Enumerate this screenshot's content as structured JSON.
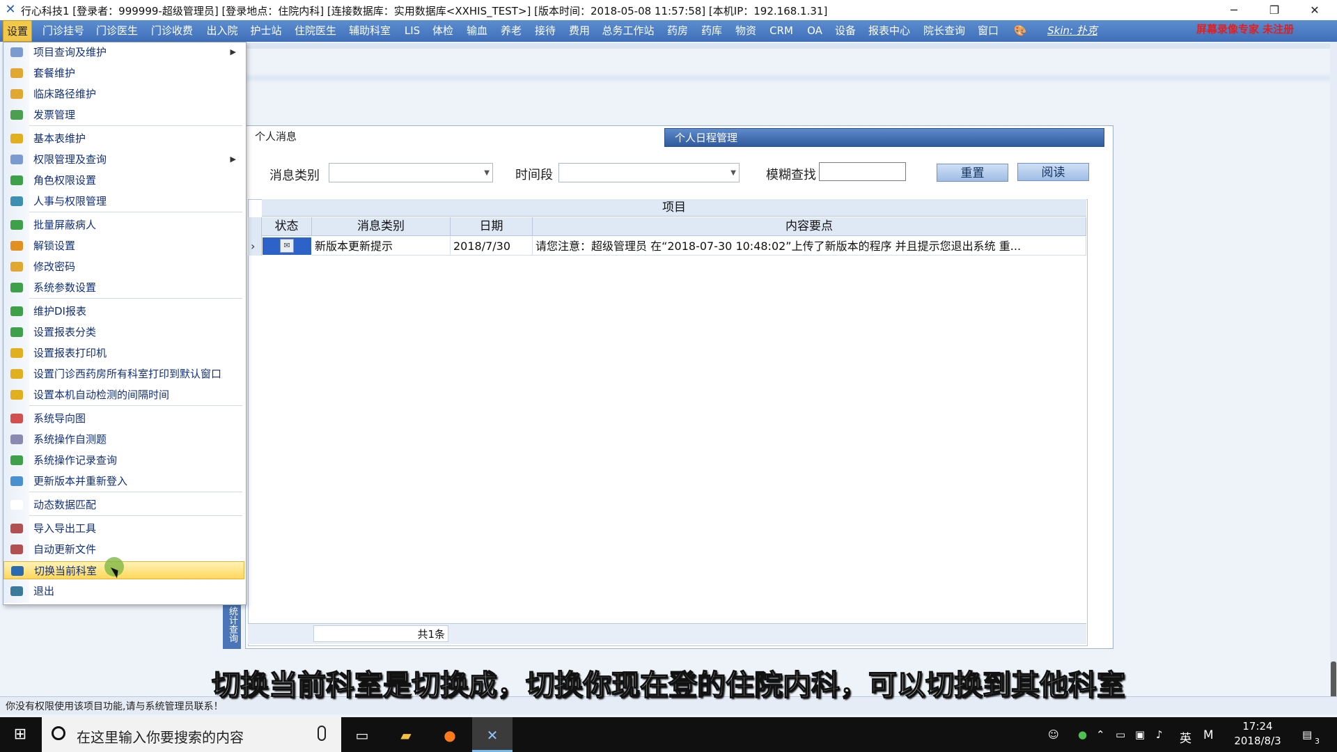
{
  "window": {
    "title": "行心科技1  [登录者：999999-超级管理员]  [登录地点：住院内科]  [连接数据库：实用数据库<XXHIS_TEST>]  [版本时间：2018-05-08 11:57:58]        [本机IP：192.168.1.31]",
    "minimize": "─",
    "restore": "❐",
    "close": "✕"
  },
  "menubar": {
    "items": [
      "设置",
      "门诊挂号",
      "门诊医生",
      "门诊收费",
      "出入院",
      "护士站",
      "住院医生",
      "辅助科室",
      "LIS",
      "体检",
      "输血",
      "养老",
      "接待",
      "费用",
      "总务工作站",
      "药房",
      "药库",
      "物资",
      "CRM",
      "OA",
      "设备",
      "报表中心",
      "院长查询",
      "窗口"
    ],
    "skin": "Skin: 扑克",
    "watermark": "屏幕录像专家  未注册"
  },
  "dropdown": {
    "items": [
      {
        "label": "项目查询及维护",
        "submenu": true,
        "color": "#7a9ad0"
      },
      {
        "label": "套餐维护",
        "color": "#e0a830"
      },
      {
        "label": "临床路径维护",
        "color": "#e0a830"
      },
      {
        "label": "发票管理",
        "color": "#4aa050"
      },
      {
        "label": "基本表维护",
        "color": "#e0b020"
      },
      {
        "label": "权限管理及查询",
        "submenu": true,
        "color": "#7a9ad0"
      },
      {
        "label": "角色权限设置",
        "color": "#3fa04a"
      },
      {
        "label": "人事与权限管理",
        "color": "#3f8fb0"
      },
      {
        "label": "批量屏蔽病人",
        "color": "#3fa04a"
      },
      {
        "label": "解锁设置",
        "color": "#e09020"
      },
      {
        "label": "修改密码",
        "color": "#e0a830"
      },
      {
        "label": "系统参数设置",
        "color": "#3fa04a"
      },
      {
        "label": "维护DI报表",
        "color": "#3fa04a"
      },
      {
        "label": "设置报表分类",
        "color": "#3fa04a"
      },
      {
        "label": "设置报表打印机",
        "color": "#e0b020"
      },
      {
        "label": "设置门诊西药房所有科室打印到默认窗口",
        "color": "#e0b020"
      },
      {
        "label": "设置本机自动检测的间隔时间",
        "color": "#e0b020"
      },
      {
        "label": "系统导向图",
        "color": "#d05050"
      },
      {
        "label": "系统操作自测题",
        "color": "#8a8ab0"
      },
      {
        "label": "系统操作记录查询",
        "color": "#3fa04a"
      },
      {
        "label": "更新版本并重新登入",
        "color": "#4a90d0"
      },
      {
        "label": "动态数据匹配",
        "color": "#ffffff"
      },
      {
        "label": "导入导出工具",
        "color": "#b05050"
      },
      {
        "label": "自动更新文件",
        "color": "#b05050"
      },
      {
        "label": "切换当前科室",
        "color": "#2a6ab0",
        "highlight": true
      },
      {
        "label": "退出",
        "color": "#3a7a9a"
      }
    ]
  },
  "panel": {
    "tab_personal": "个人消息",
    "tab_schedule": "个人日程管理",
    "filter": {
      "category_label": "消息类别",
      "category_value": "",
      "period_label": "时间段",
      "period_value": "",
      "search_label": "模糊查找",
      "search_value": "",
      "reset_button": "重置",
      "read_button": "阅读"
    },
    "grid": {
      "band_title": "项目",
      "columns": [
        "状态",
        "消息类别",
        "日期",
        "内容要点"
      ],
      "rows": [
        {
          "status": "",
          "category": "新版本更新提示",
          "date": "2018/7/30",
          "content": "请您注意：超级管理员 在“2018-07-30 10:48:02”上传了新版本的程序 并且提示您退出系统 重..."
        }
      ],
      "row_indicator": "›",
      "count": "共1条"
    },
    "side_tab": "统计查询"
  },
  "statusbar": {
    "message": "你没有权限使用该项目功能,请与系统管理员联系！"
  },
  "subtitle": "切换当前科室是切换成，切换你现在登的住院内科，可以切换到其他科室",
  "taskbar": {
    "search_placeholder": "在这里输入你要搜索的内容",
    "ime_lang": "英",
    "ime_mode": "M",
    "time": "17:24",
    "date": "2018/8/3",
    "notification_count": "3"
  }
}
